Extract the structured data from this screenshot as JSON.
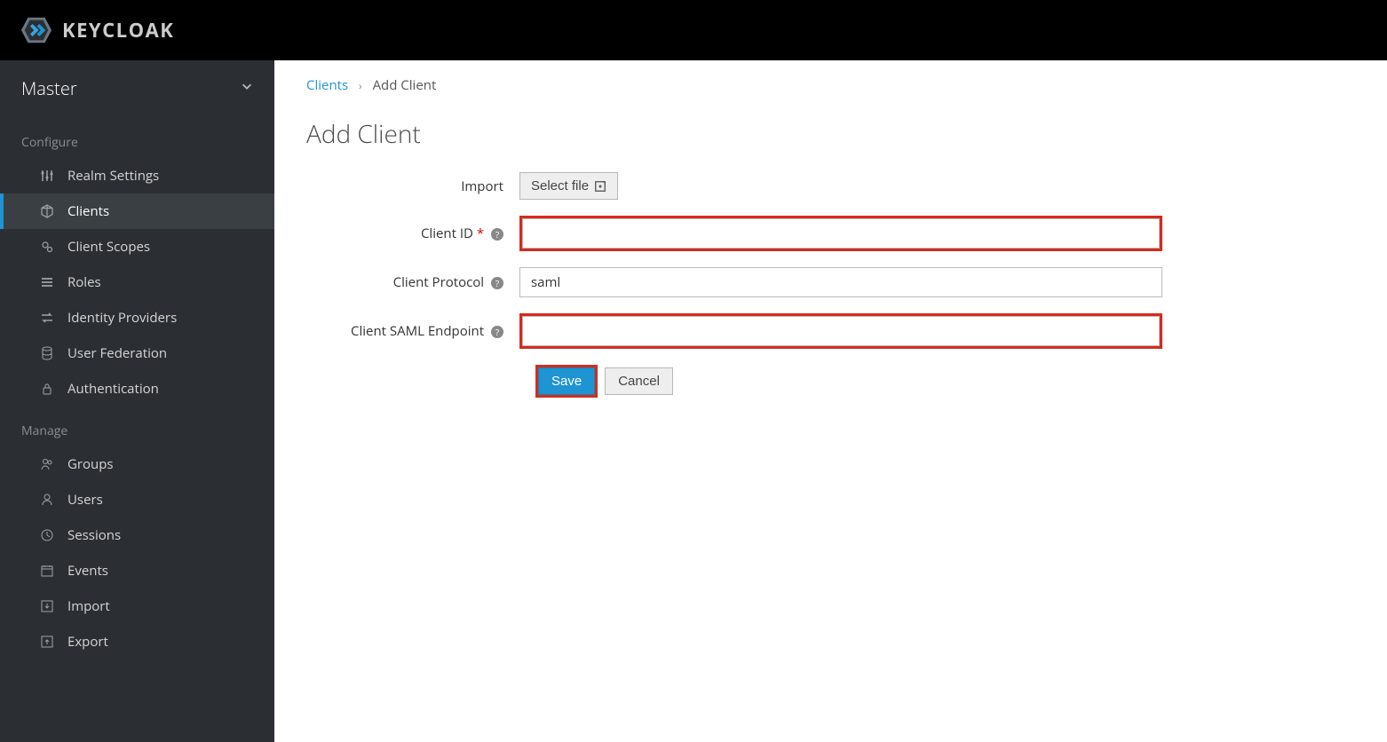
{
  "brand": "KEYCLOAK",
  "realm": {
    "name": "Master"
  },
  "sidebar": {
    "sections": [
      {
        "label": "Configure",
        "items": [
          {
            "key": "realm-settings",
            "label": "Realm Settings",
            "icon": "sliders"
          },
          {
            "key": "clients",
            "label": "Clients",
            "icon": "cube",
            "active": true
          },
          {
            "key": "client-scopes",
            "label": "Client Scopes",
            "icon": "cogs"
          },
          {
            "key": "roles",
            "label": "Roles",
            "icon": "list"
          },
          {
            "key": "identity-providers",
            "label": "Identity Providers",
            "icon": "exchange"
          },
          {
            "key": "user-federation",
            "label": "User Federation",
            "icon": "database"
          },
          {
            "key": "authentication",
            "label": "Authentication",
            "icon": "lock"
          }
        ]
      },
      {
        "label": "Manage",
        "items": [
          {
            "key": "groups",
            "label": "Groups",
            "icon": "users"
          },
          {
            "key": "users",
            "label": "Users",
            "icon": "user"
          },
          {
            "key": "sessions",
            "label": "Sessions",
            "icon": "clock"
          },
          {
            "key": "events",
            "label": "Events",
            "icon": "calendar"
          },
          {
            "key": "import",
            "label": "Import",
            "icon": "import"
          },
          {
            "key": "export",
            "label": "Export",
            "icon": "export"
          }
        ]
      }
    ]
  },
  "breadcrumb": {
    "parent": "Clients",
    "current": "Add Client"
  },
  "page": {
    "title": "Add Client"
  },
  "form": {
    "import_label": "Import",
    "select_file_label": "Select file",
    "client_id_label": "Client ID",
    "client_id_value": "",
    "client_protocol_label": "Client Protocol",
    "client_protocol_value": "saml",
    "client_saml_endpoint_label": "Client SAML Endpoint",
    "client_saml_endpoint_value": "",
    "save_label": "Save",
    "cancel_label": "Cancel"
  }
}
